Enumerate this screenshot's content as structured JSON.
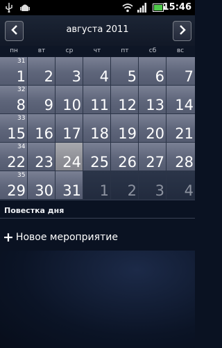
{
  "status_bar": {
    "time": "15:46",
    "icons": [
      "usb-icon",
      "android-debug-icon",
      "wifi-icon",
      "signal-icon",
      "battery-icon"
    ]
  },
  "header": {
    "prev_icon": "chevron-left-icon",
    "title": "августа 2011",
    "next_icon": "chevron-right-icon"
  },
  "weekdays": [
    "пн",
    "вт",
    "ср",
    "чт",
    "пт",
    "сб",
    "вс"
  ],
  "calendar": {
    "week_numbers": [
      "31",
      "32",
      "33",
      "34",
      "35"
    ],
    "weeks": [
      [
        "1",
        "2",
        "3",
        "4",
        "5",
        "6",
        "7"
      ],
      [
        "8",
        "9",
        "10",
        "11",
        "12",
        "13",
        "14"
      ],
      [
        "15",
        "16",
        "17",
        "18",
        "19",
        "20",
        "21"
      ],
      [
        "22",
        "23",
        "24",
        "25",
        "26",
        "27",
        "28"
      ],
      [
        "29",
        "30",
        "31",
        "1",
        "2",
        "3",
        "4"
      ]
    ],
    "selected": "24"
  },
  "agenda": {
    "title": "Повестка дня",
    "new_event_icon": "+",
    "new_event_label": "Новое мероприятие"
  }
}
